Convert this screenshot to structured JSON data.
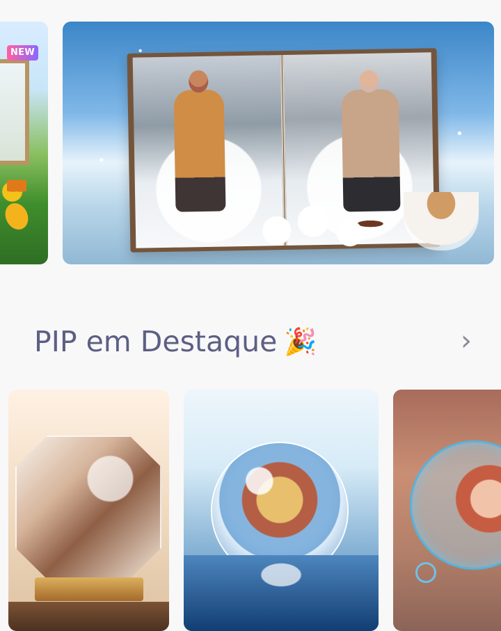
{
  "badges": {
    "new_label": "NEW"
  },
  "sections": {
    "featured_pip": {
      "title": "PIP em Destaque",
      "emoji": "🎉",
      "chevron": "›"
    }
  },
  "colors": {
    "background": "#f8f8f9",
    "title_text": "#5c5f83",
    "chevron": "#8a8b98",
    "badge_gradient_start": "#ff5fa2",
    "badge_gradient_end": "#8b67ff"
  },
  "icons": {
    "chevron": "chevron-right-icon",
    "emoji": "party-popper-icon"
  }
}
